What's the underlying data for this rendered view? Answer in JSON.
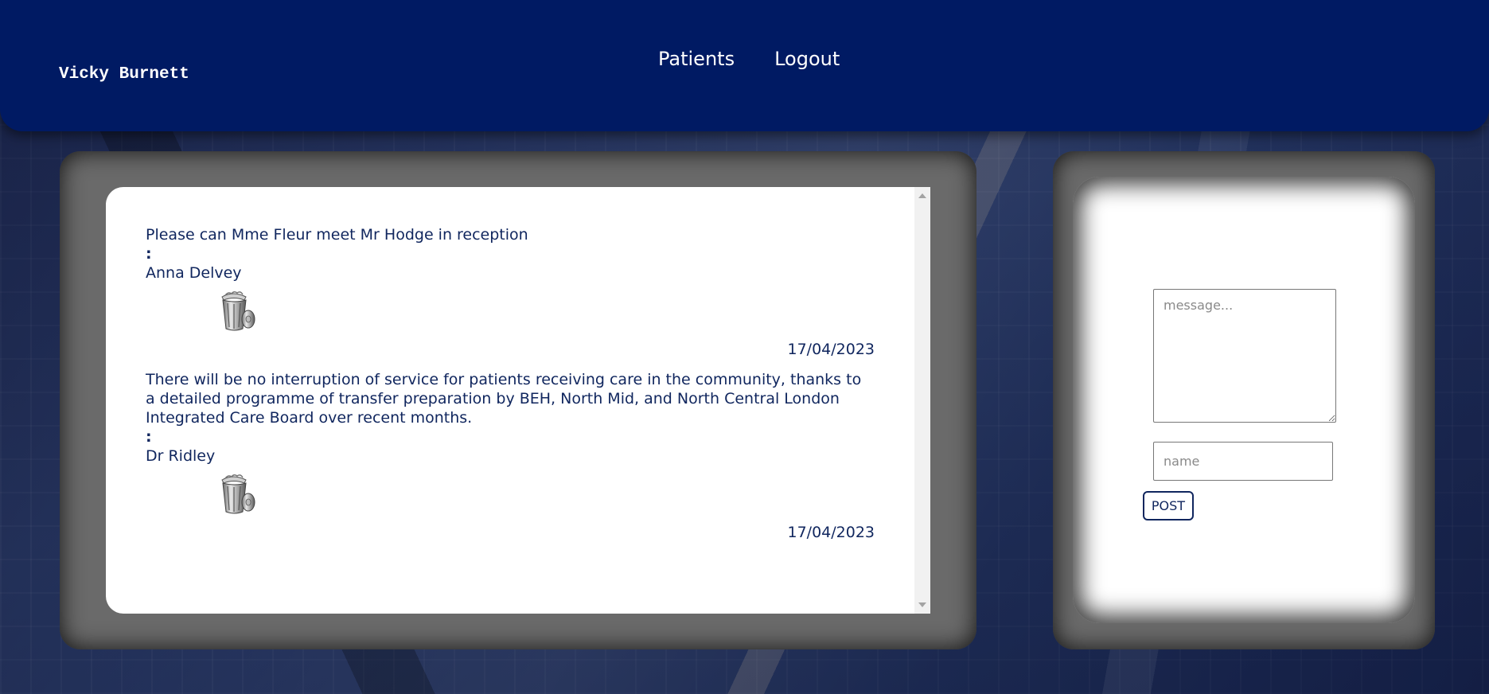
{
  "header": {
    "user_name": "Vicky Burnett",
    "nav": [
      {
        "label": "Patients"
      },
      {
        "label": "Logout"
      }
    ],
    "background_color": "#001a63"
  },
  "messages": [
    {
      "text": "Please can Mme Fleur meet Mr Hodge in reception",
      "separator": ":",
      "author": "Anna Delvey",
      "delete_icon": "trash-can-icon",
      "date": "17/04/2023"
    },
    {
      "text": "There will be no interruption of service for patients receiving care in the community, thanks to a detailed programme of transfer preparation by BEH, North Mid, and North Central London Integrated Care Board over recent months.",
      "separator": ":",
      "author": "Dr Ridley",
      "delete_icon": "trash-can-icon",
      "date": "17/04/2023"
    }
  ],
  "form": {
    "message_placeholder": "message...",
    "name_placeholder": "name",
    "post_label": "POST"
  },
  "colors": {
    "text_primary": "#10265e",
    "panel_frame": "#6a6a6a"
  }
}
